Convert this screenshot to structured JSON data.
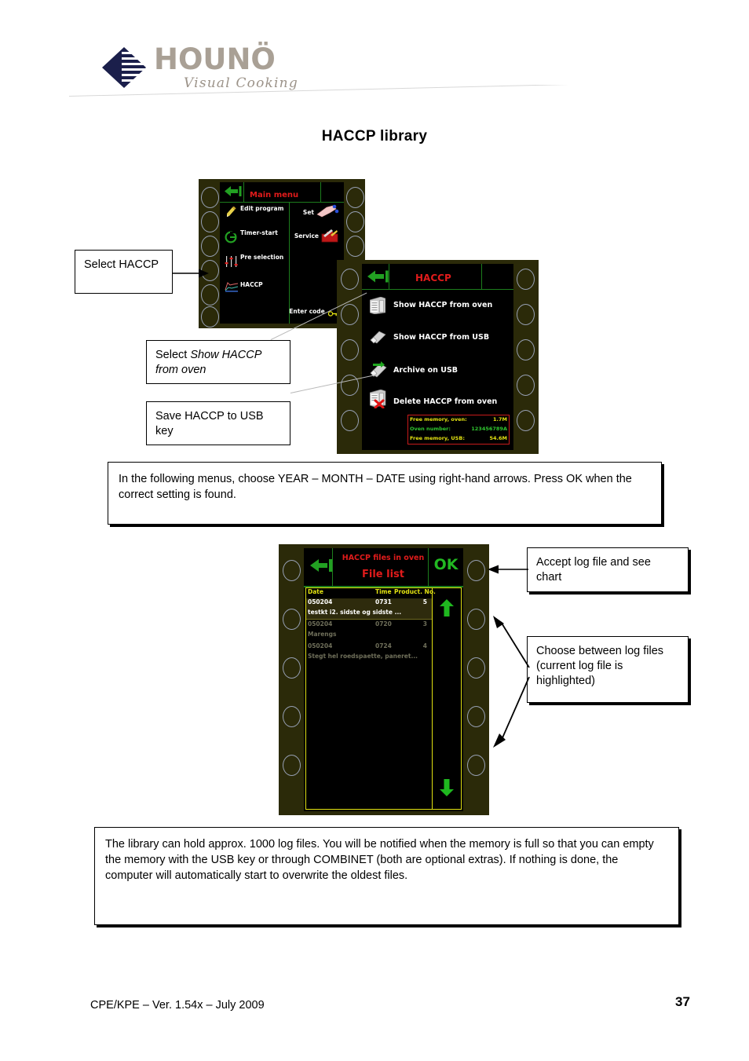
{
  "document": {
    "title": "HACCP library",
    "footer_left": "CPE/KPE – Ver. 1.54x – July 2009",
    "page_number": "37"
  },
  "brand": {
    "name": "HOUNÖ",
    "tagline": "Visual Cooking",
    "logo_color": "#1b1f4b",
    "wordmark_color": "#a9a095"
  },
  "screen_main_menu": {
    "title": "Main menu",
    "title_color": "#e01b1b",
    "back_icon": "back-arrow-icon",
    "left_items": [
      {
        "label": "Edit program",
        "icon": "edit-program-icon"
      },
      {
        "label": "Timer-start",
        "icon": "timer-start-icon"
      },
      {
        "label": "Pre selection",
        "icon": "pre-selection-icon"
      },
      {
        "label": "HACCP",
        "icon": "haccp-chart-icon"
      }
    ],
    "right_items": [
      {
        "label": "Set",
        "icon": "settings-hand-icon"
      },
      {
        "label": "Service",
        "icon": "service-toolbox-icon"
      }
    ],
    "footer_item": {
      "label": "Enter code",
      "icon": "key-icon"
    }
  },
  "screen_haccp_menu": {
    "title": "HACCP",
    "title_color": "#e01b1b",
    "back_icon": "back-arrow-icon",
    "items": [
      {
        "label": "Show HACCP from oven",
        "icon": "oven-icon"
      },
      {
        "label": "Show HACCP from USB",
        "icon": "usb-stick-icon"
      },
      {
        "label": "Archive on USB",
        "icon": "usb-archive-icon"
      },
      {
        "label": "Delete HACCP from oven",
        "icon": "oven-delete-icon"
      }
    ],
    "memory_box": {
      "border_color": "#c81b1b",
      "rows": [
        {
          "label": "Free memory, oven:",
          "value": "1.7M",
          "color": "#e2e211"
        },
        {
          "label": "Oven number:",
          "value": "123456789A",
          "color": "#2fc52f"
        },
        {
          "label": "Free memory, USB:",
          "value": "54.6M",
          "color": "#e2e211"
        }
      ]
    }
  },
  "screen_file_list": {
    "title_line1": "HACCP files in oven",
    "title_line2": "File list",
    "title_color": "#e01b1b",
    "back_icon": "back-arrow-icon",
    "ok_label": "OK",
    "ok_color": "#22b822",
    "scroll_up_icon": "arrow-up-icon",
    "scroll_down_icon": "arrow-down-icon",
    "columns": [
      "Date",
      "Time",
      "Product. No."
    ],
    "rows": [
      {
        "date": "050204",
        "time": "0731",
        "number": "5",
        "product": "testkt i2. sidste og sidste ...",
        "highlighted": true
      },
      {
        "date": "050204",
        "time": "0720",
        "number": "3",
        "product": "Marengs",
        "highlighted": false
      },
      {
        "date": "050204",
        "time": "0724",
        "number": "4",
        "product": "Stegt hel roedspaette, paneret...",
        "highlighted": false
      }
    ]
  },
  "callouts": {
    "select_haccp": "Select HACCP",
    "select_show_haccp_prefix": "Select ",
    "select_show_haccp_italic": "Show HACCP from oven",
    "save_haccp_usb": "Save HACCP to USB key",
    "accept_log_file": "Accept log file and see chart",
    "choose_between_logs": "Choose between log files (current log file is highlighted)"
  },
  "notes": {
    "note_menus": "In the following menus, choose YEAR – MONTH – DATE using right-hand arrows. Press OK when the correct setting is found.",
    "note_library": "The library can hold approx. 1000 log files. You will be notified when the memory is full so that you can empty the memory with the USB key or through COMBINET (both are optional extras). If nothing is done, the computer will automatically start to overwrite the oldest files."
  }
}
